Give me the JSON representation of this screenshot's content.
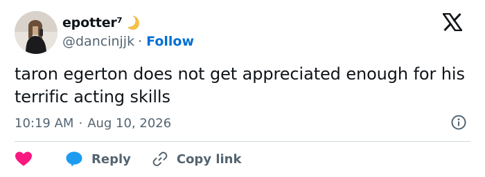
{
  "author": {
    "display_name": "epotter⁷",
    "handle": "@dancinjjk",
    "follow_label": "Follow",
    "avatar_icon": "profile-photo",
    "emoji_icon": "crescent-moon-icon"
  },
  "brand": {
    "logo": "x-logo-icon"
  },
  "tweet": {
    "text": "taron egerton does not get appreciated enough for his terrific acting skills",
    "time": "10:19 AM",
    "date": "Aug 10, 2026",
    "info_icon": "info-icon"
  },
  "actions": {
    "like_icon": "heart-icon",
    "reply_icon": "speech-bubble-icon",
    "reply_label": "Reply",
    "copy_icon": "link-icon",
    "copy_label": "Copy link"
  },
  "colors": {
    "text": "#0f1419",
    "muted": "#536471",
    "link": "#006fd6",
    "heart": "#f91880",
    "reply_bubble": "#1d9bf0",
    "divider": "#cfd9de"
  }
}
